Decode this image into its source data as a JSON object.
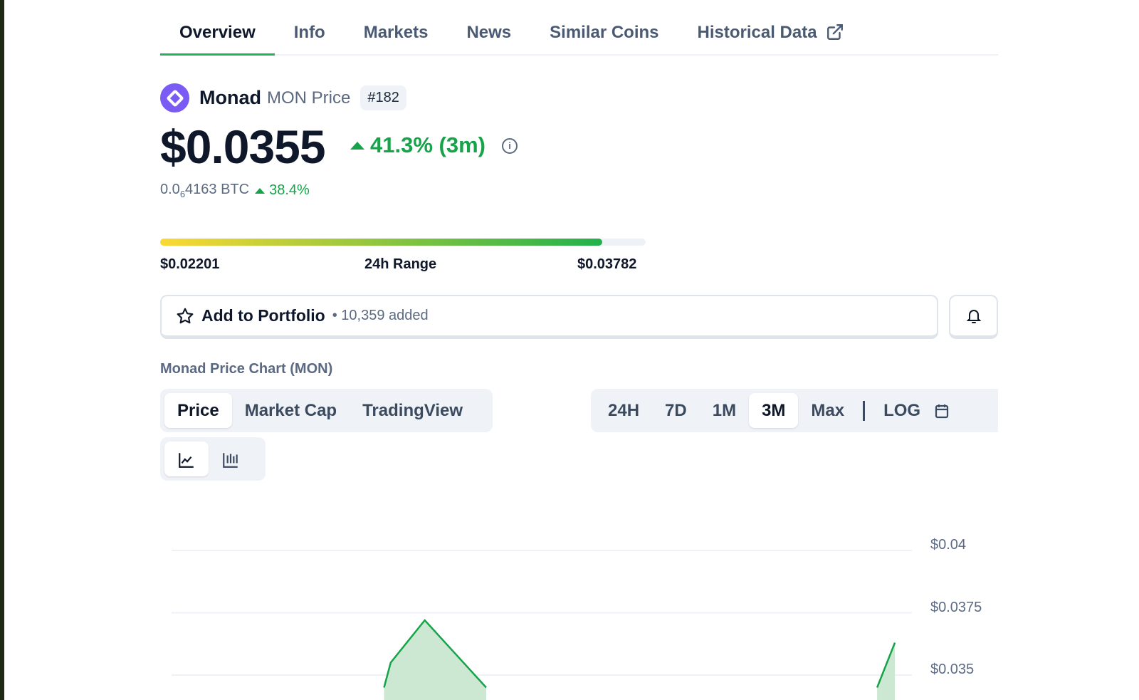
{
  "tabs": [
    {
      "label": "Overview",
      "active": true
    },
    {
      "label": "Info"
    },
    {
      "label": "Markets"
    },
    {
      "label": "News"
    },
    {
      "label": "Similar Coins"
    },
    {
      "label": "Historical Data",
      "icon": "external-link-icon"
    }
  ],
  "coin": {
    "name": "Monad",
    "symbol_label": "MON Price",
    "rank": "#182",
    "price": "$0.0355",
    "change": "41.3% (3m)",
    "btc_prefix": "0.0",
    "btc_sub": "6",
    "btc_rest": "4163 BTC",
    "btc_change": "38.4%",
    "accent": "#16a34a",
    "logo_color": "#7a5cf5"
  },
  "range": {
    "low": "$0.02201",
    "label": "24h Range",
    "high": "$0.03782",
    "fill_percent": 91
  },
  "portfolio": {
    "label": "Add to Portfolio",
    "count": "• 10,359 added"
  },
  "chart_title": "Monad Price Chart (MON)",
  "chart_types": [
    "Price",
    "Market Cap",
    "TradingView"
  ],
  "periods": [
    "24H",
    "7D",
    "1M",
    "3M",
    "Max"
  ],
  "log_label": "LOG",
  "chart_data": {
    "type": "area",
    "y_ticks": [
      "$0.04",
      "$0.0375",
      "$0.035"
    ],
    "y_tick_values": [
      0.04,
      0.0375,
      0.035
    ],
    "series": [
      {
        "name": "Price",
        "points": [
          [
            0.287,
            0.0345
          ],
          [
            0.296,
            0.0355
          ],
          [
            0.342,
            0.0372
          ],
          [
            0.425,
            0.0345
          ],
          [
            0.953,
            0.0345
          ],
          [
            0.977,
            0.0363
          ]
        ]
      }
    ]
  }
}
